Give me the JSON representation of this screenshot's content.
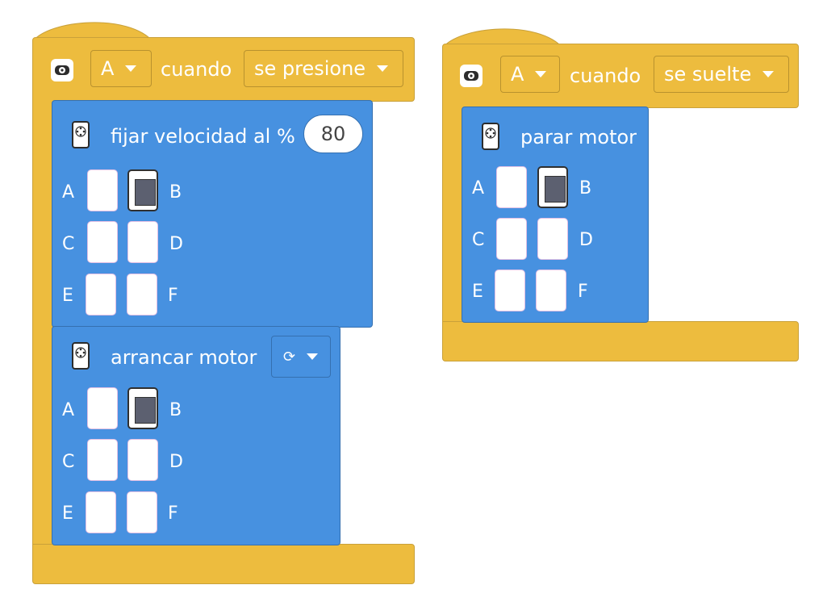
{
  "colors": {
    "event_block": "#EDBC3E",
    "motor_block": "#4791E0",
    "port_active": "#5C6070"
  },
  "event1": {
    "port_value": "A",
    "when_label": "cuando",
    "trigger_value": "se presione",
    "set_speed": {
      "label": "fijar velocidad al %",
      "speed_value": "80",
      "ports": [
        "A",
        "B",
        "C",
        "D",
        "E",
        "F"
      ],
      "active_ports": [
        "B"
      ]
    },
    "start_motor": {
      "label": "arrancar motor",
      "direction_icon": "rotate-clockwise-icon",
      "direction_glyph": "⟳",
      "ports": [
        "A",
        "B",
        "C",
        "D",
        "E",
        "F"
      ],
      "active_ports": [
        "B"
      ]
    }
  },
  "event2": {
    "port_value": "A",
    "when_label": "cuando",
    "trigger_value": "se suelte",
    "stop_motor": {
      "label": "parar motor",
      "ports": [
        "A",
        "B",
        "C",
        "D",
        "E",
        "F"
      ],
      "active_ports": [
        "B"
      ]
    }
  }
}
